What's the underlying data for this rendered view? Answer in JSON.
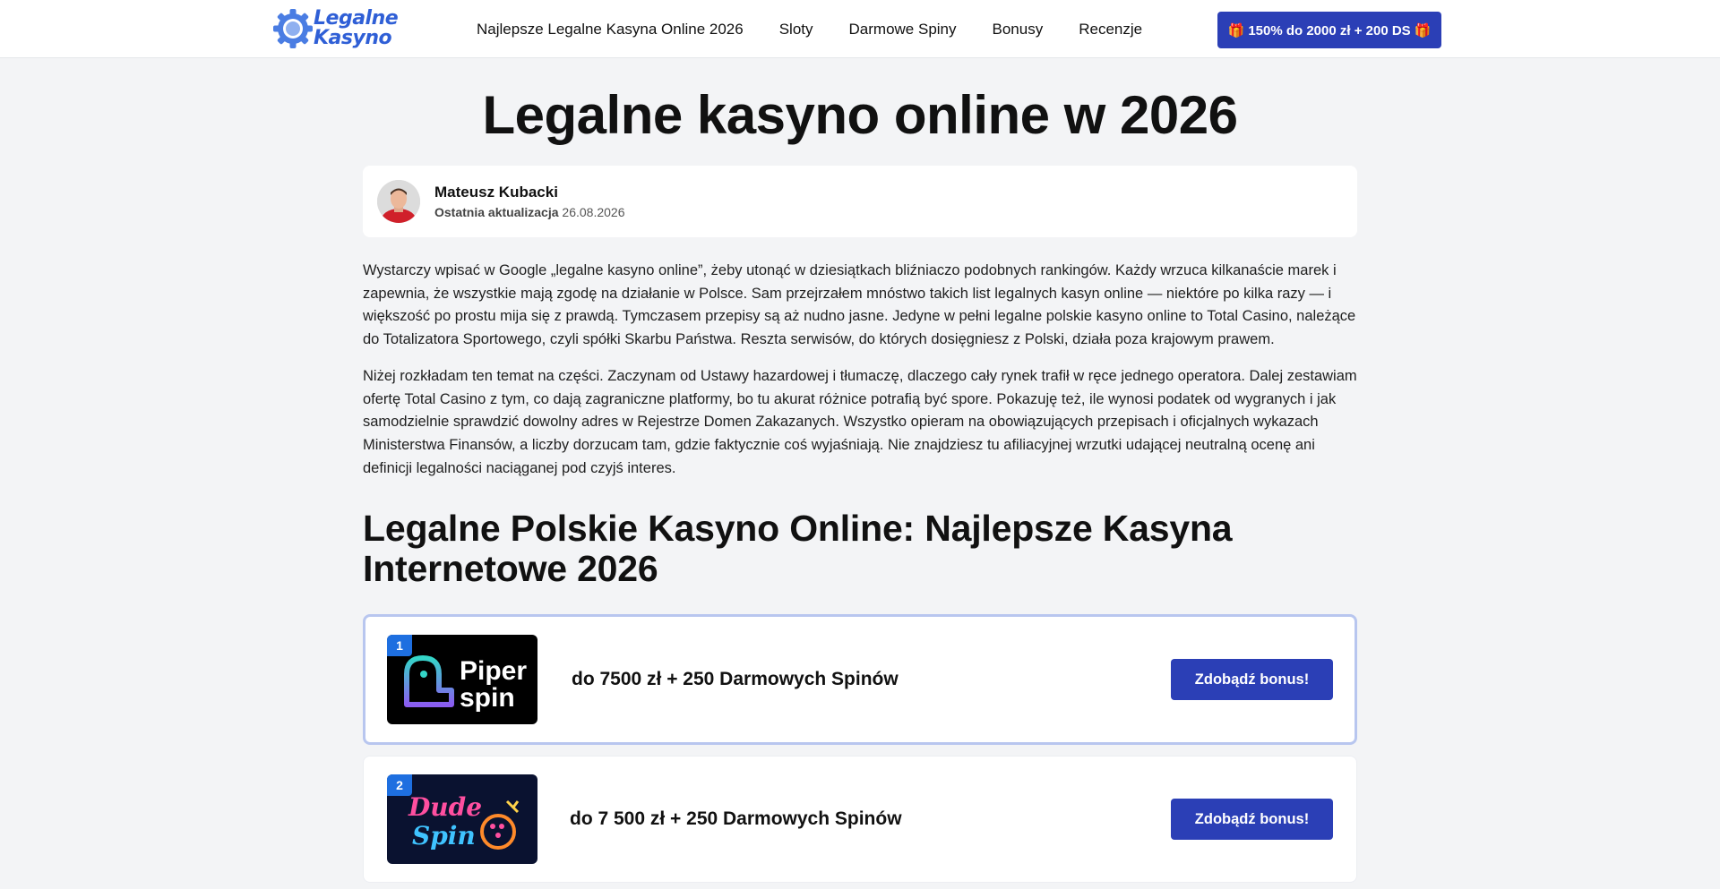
{
  "header": {
    "logo": {
      "line1": "Legalne",
      "line2": "Kasyno",
      "icon": "gear-chip-logo-icon"
    },
    "nav": [
      "Najlepsze Legalne Kasyna Online 2026",
      "Sloty",
      "Darmowe Spiny",
      "Bonusy",
      "Recenzje"
    ],
    "cta": "🎁 150% do 2000 zł + 200 DS 🎁"
  },
  "page": {
    "title": "Legalne kasyno online w 2026"
  },
  "author": {
    "name": "Mateusz Kubacki",
    "updated_label": "Ostatnia aktualizacja",
    "updated_date": "26.08.2026"
  },
  "intro": [
    "Wystarczy wpisać w Google „legalne kasyno online”, żeby utonąć w dziesiątkach bliźniaczo podobnych rankingów. Każdy wrzuca kilkanaście marek i zapewnia, że wszystkie mają zgodę na działanie w Polsce. Sam przejrzałem mnóstwo takich list legalnych kasyn online — niektóre po kilka razy — i większość po prostu mija się z prawdą. Tymczasem przepisy są aż nudno jasne. Jedyne w pełni legalne polskie kasyno online to Total Casino, należące do Totalizatora Sportowego, czyli spółki Skarbu Państwa. Reszta serwisów, do których dosięgniesz z Polski, działa poza krajowym prawem.",
    "Niżej rozkładam ten temat na części. Zaczynam od Ustawy hazardowej i tłumaczę, dlaczego cały rynek trafił w ręce jednego operatora. Dalej zestawiam ofertę Total Casino z tym, co dają zagraniczne platformy, bo tu akurat różnice potrafią być spore. Pokazuję też, ile wynosi podatek od wygranych i jak samodzielnie sprawdzić dowolny adres w Rejestrze Domen Zakazanych. Wszystko opieram na obowiązujących przepisach i oficjalnych wykazach Ministerstwa Finansów, a liczby dorzucam tam, gdzie faktycznie coś wyjaśniają. Nie znajdziesz tu afiliacyjnej wrzutki udającej neutralną ocenę ani definicji legalności naciąganej pod czyjś interes."
  ],
  "section": {
    "title": "Legalne Polskie Kasyno Online: Najlepsze Kasyna Internetowe 2026"
  },
  "casinos": [
    {
      "rank": "1",
      "logo_line1": "Piper",
      "logo_line2": "spin",
      "bonus": "do 7500 zł + 250 Darmowych Spinów",
      "button": "Zdobądź bonus!"
    },
    {
      "rank": "2",
      "logo_line1": "Dude",
      "logo_line2": "Spin",
      "bonus": "do 7 500 zł + 250 Darmowych Spinów",
      "button": "Zdobądź bonus!"
    }
  ],
  "colors": {
    "accent": "#2b3fb6",
    "logo_blue": "#2f5fd6",
    "rank_badge": "#1e6fe0",
    "page_bg": "#f3f4f6",
    "highlight_border": "#b8c6ef"
  }
}
